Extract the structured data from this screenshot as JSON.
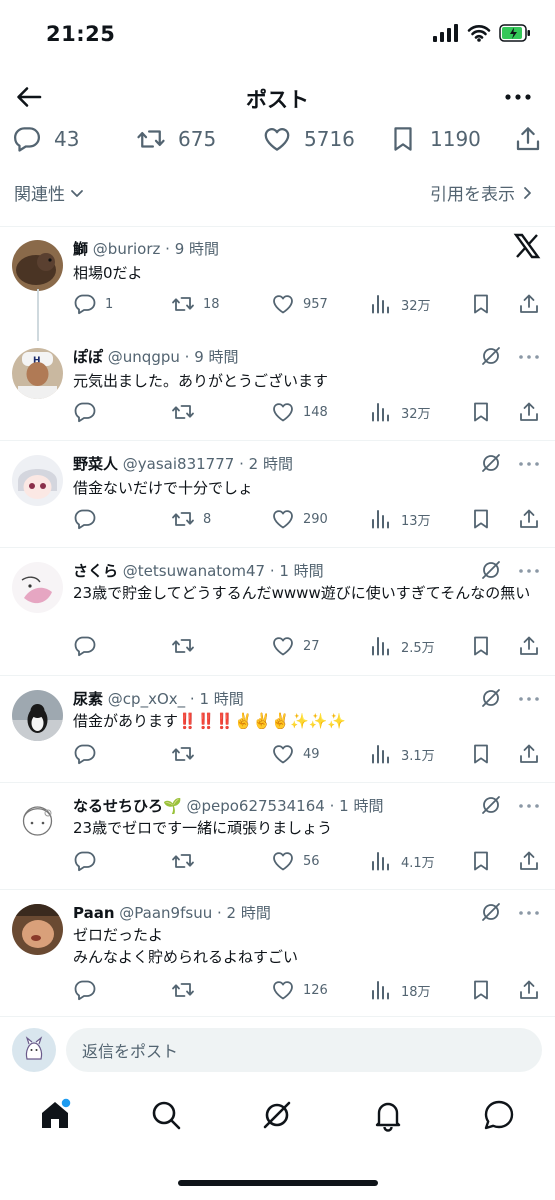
{
  "status_bar": {
    "time": "21:25"
  },
  "header": {
    "title": "ポスト"
  },
  "stats": {
    "replies": "43",
    "reposts": "675",
    "likes": "5716",
    "bookmarks": "1190"
  },
  "sort": {
    "label": "関連性",
    "quotes_label": "引用を表示"
  },
  "replies": [
    {
      "name": "鰤",
      "handle": "@buriorz",
      "time": "· 9 時間",
      "text": "相場0だよ",
      "replies": "1",
      "reposts": "18",
      "likes": "957",
      "views": "32万"
    },
    {
      "name": "ぽぽ",
      "handle": "@unqgpu",
      "time": "· 9 時間",
      "text": "元気出ました。ありがとうございます",
      "replies": "",
      "reposts": "",
      "likes": "148",
      "views": "32万"
    },
    {
      "name": "野菜人",
      "handle": "@yasai831777",
      "time": "· 2 時間",
      "text": "借金ないだけで十分でしょ",
      "replies": "",
      "reposts": "8",
      "likes": "290",
      "views": "13万"
    },
    {
      "name": "さくら",
      "handle": "@tetsuwanatom47",
      "time": "· 1 時間",
      "text": "23歳で貯金してどうするんだwwww遊びに使いすぎてそんなの無い",
      "replies": "",
      "reposts": "",
      "likes": "27",
      "views": "2.5万"
    },
    {
      "name": "尿素",
      "handle": "@cp_xOx_",
      "time": "· 1 時間",
      "text": "借金があります‼️‼️‼️✌️✌️✌️✨✨✨",
      "replies": "",
      "reposts": "",
      "likes": "49",
      "views": "3.1万"
    },
    {
      "name": "なるせちひろ🌱",
      "handle": "@pepo627534164",
      "time": "· 1 時間",
      "text": "23歳でゼロです一緒に頑張りましょう",
      "replies": "",
      "reposts": "",
      "likes": "56",
      "views": "4.1万"
    },
    {
      "name": "Paan",
      "handle": "@Paan9fsuu",
      "time": "· 2 時間",
      "text_lines": [
        "ゼロだったよ",
        "みんなよく貯められるよねすごい"
      ],
      "replies": "",
      "reposts": "",
      "likes": "126",
      "views": "18万"
    }
  ],
  "reply_bar": {
    "placeholder": "返信をポスト"
  },
  "colors": {
    "text": "#0f1419",
    "secondary": "#536471",
    "divider": "#eff3f4",
    "badge": "#1d9bf0"
  },
  "icons": [
    "back-arrow-icon",
    "more-icon",
    "reply-icon",
    "repost-icon",
    "like-icon",
    "bookmark-icon",
    "share-icon",
    "views-icon",
    "grok-icon",
    "x-logo-icon",
    "home-icon",
    "search-icon",
    "notifications-icon",
    "messages-icon"
  ]
}
